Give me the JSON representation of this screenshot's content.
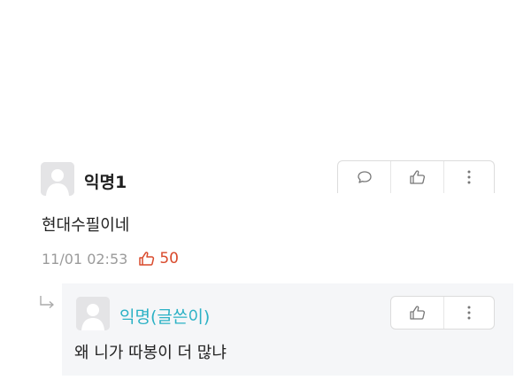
{
  "comment": {
    "author": "익명1",
    "body": "현대수필이네",
    "timestamp": "11/01 02:53",
    "like_count": "50",
    "actions": [
      "comment-icon",
      "thumbs-up-icon",
      "more-vertical-icon"
    ]
  },
  "reply": {
    "author": "익명(글쓴이)",
    "body": "왜 니가 따봉이 더 많냐",
    "actions": [
      "thumbs-up-icon",
      "more-vertical-icon"
    ]
  },
  "colors": {
    "op_author": "#2ab1c5",
    "like_count": "#d94a2c",
    "reply_background": "#f5f6f8"
  }
}
